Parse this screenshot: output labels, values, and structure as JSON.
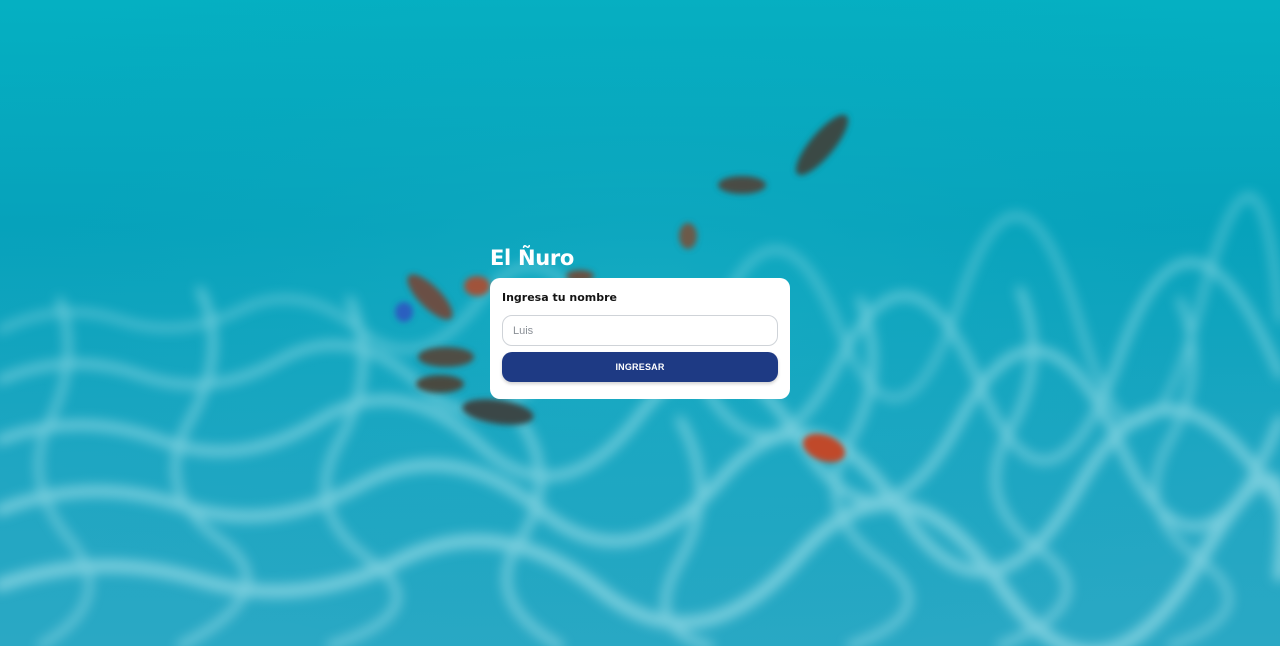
{
  "app": {
    "title": "El Ñuro"
  },
  "form": {
    "label": "Ingresa tu nombre",
    "name_value": "",
    "name_placeholder": "Luis",
    "submit_label": "INGRESAR"
  },
  "colors": {
    "water": "#0aa5bd",
    "button": "#1e3a84",
    "card": "#ffffff",
    "title": "#ffffff"
  },
  "icons": {
    "background": "underwater-photo"
  }
}
